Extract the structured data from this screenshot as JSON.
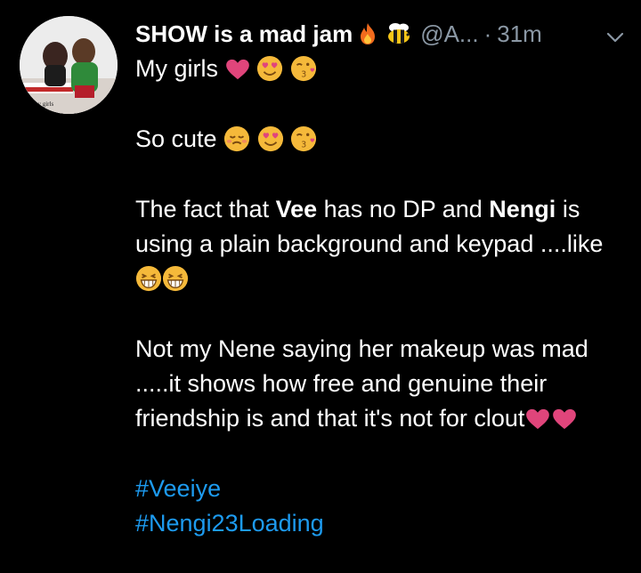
{
  "tweet": {
    "avatar_caption": "My Fav girls",
    "author_name": "SHOW is a mad jam",
    "handle": "@A...",
    "separator": "·",
    "time": "31m",
    "line1": "My girls",
    "line2": "So cute",
    "p3_a": "The fact that ",
    "p3_b": "Vee",
    "p3_c": " has no DP and ",
    "p3_d": "Nengi",
    "p3_e": " is using a plain background and keypad ....like",
    "p4_a": "Not my Nene saying her makeup was mad .....it shows how free and genuine their friendship is and that it's not for clout",
    "hashtag1": "#Veeiye",
    "hashtag2": "#Nengi23Loading"
  },
  "icons": {
    "header": [
      "fire-icon",
      "bee-icon",
      "chevron-down-icon"
    ],
    "emojis": [
      "heart-icon",
      "heart-eyes-icon",
      "kissing-icon",
      "grinning-icon"
    ]
  },
  "colors": {
    "background": "#000000",
    "text": "#ffffff",
    "muted": "#8b98a5",
    "hashtag": "#1d9bf0",
    "heart": "#e0457b",
    "emoji": "#f5b93a"
  }
}
